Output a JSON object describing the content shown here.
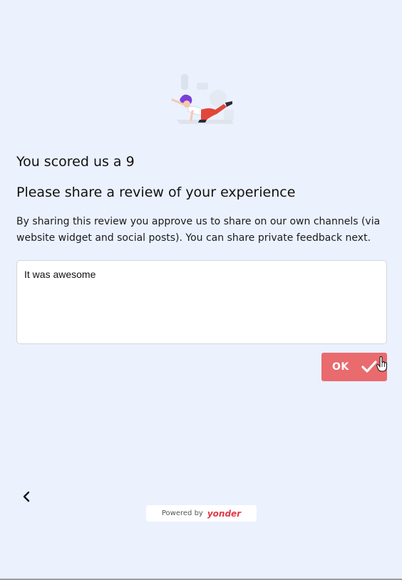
{
  "survey": {
    "score_text": "You scored us a 9",
    "question": "Please share a review of your experience",
    "consent": "By sharing this review you approve us to share on our own channels (via website widget and social posts). You can share private feedback next.",
    "review_value": "It was awesome",
    "ok_label": "OK"
  },
  "navigation": {
    "back_icon": "chevron-left-icon"
  },
  "footer": {
    "powered_by": "Powered by",
    "brand": "yonder"
  },
  "colors": {
    "background": "#ebf1fd",
    "accent": "#e96b6e",
    "brand": "#e03a4a"
  }
}
